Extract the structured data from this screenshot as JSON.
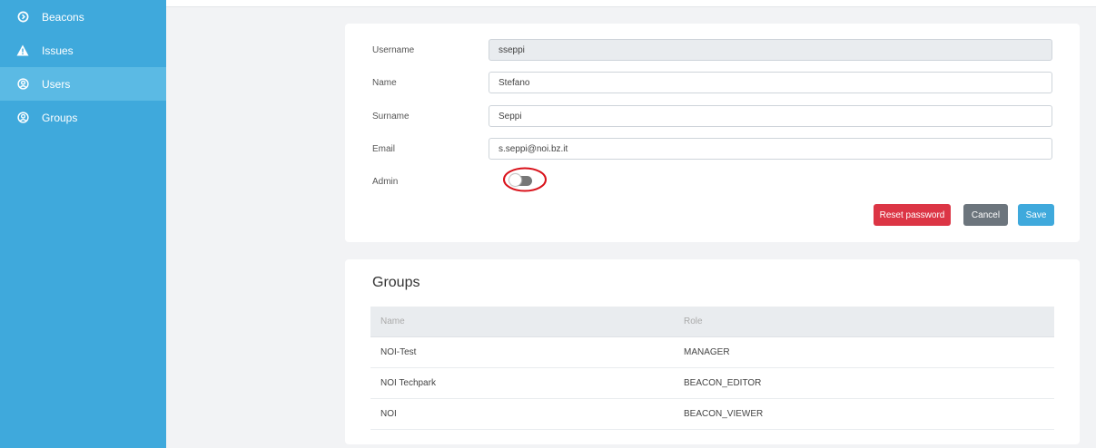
{
  "sidebar": {
    "items": [
      {
        "label": "Beacons",
        "icon": "beacon-icon",
        "active": false
      },
      {
        "label": "Issues",
        "icon": "warning-icon",
        "active": false
      },
      {
        "label": "Users",
        "icon": "user-icon",
        "active": true
      },
      {
        "label": "Groups",
        "icon": "user-icon",
        "active": false
      }
    ]
  },
  "user_form": {
    "username_label": "Username",
    "username_value": "sseppi",
    "name_label": "Name",
    "name_value": "Stefano",
    "surname_label": "Surname",
    "surname_value": "Seppi",
    "email_label": "Email",
    "email_value": "s.seppi@noi.bz.it",
    "admin_label": "Admin",
    "admin_enabled": false
  },
  "actions": {
    "reset_label": "Reset password",
    "cancel_label": "Cancel",
    "save_label": "Save"
  },
  "groups": {
    "title": "Groups",
    "columns": [
      "Name",
      "Role"
    ],
    "rows": [
      [
        "NOI-Test",
        "MANAGER"
      ],
      [
        "NOI Techpark",
        "BEACON_EDITOR"
      ],
      [
        "NOI",
        "BEACON_VIEWER"
      ]
    ]
  },
  "colors": {
    "sidebar": "#3fa9dc",
    "sidebar_active": "#5bbae4",
    "danger": "#dc3545",
    "secondary": "#6c757d",
    "primary": "#3fa9dc",
    "annotation": "#d9111a"
  }
}
